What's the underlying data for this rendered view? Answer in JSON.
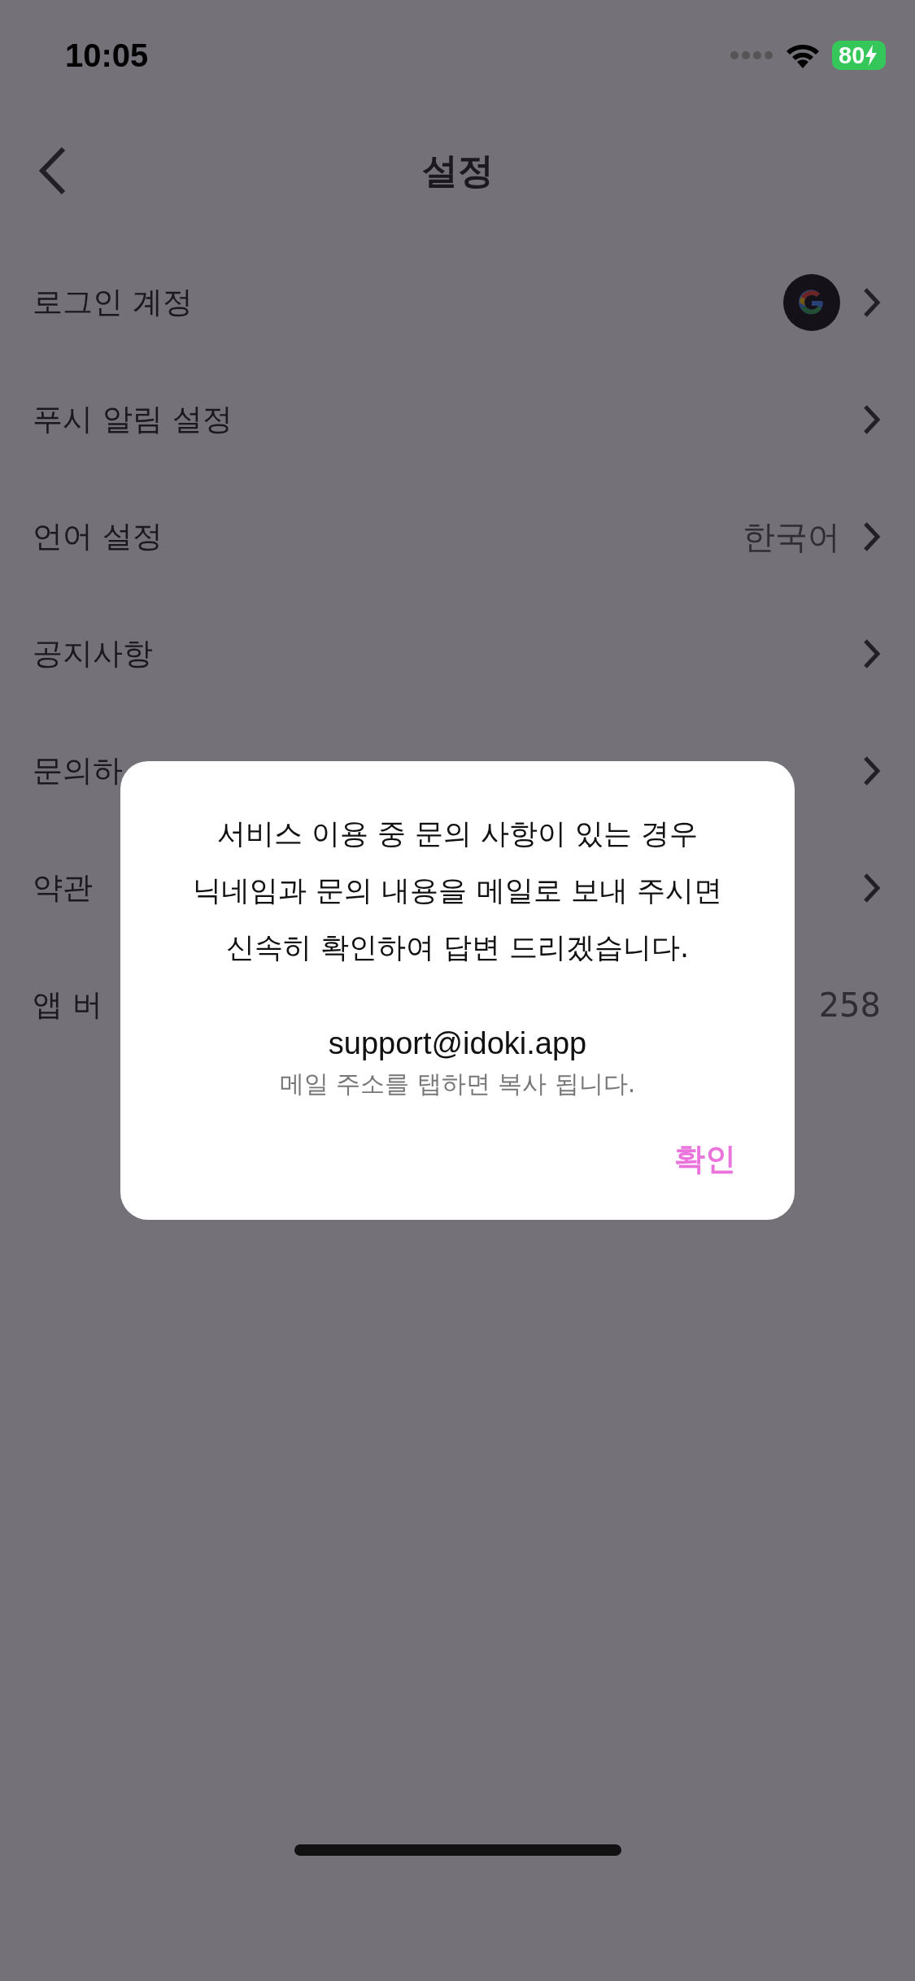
{
  "status_bar": {
    "time": "10:05",
    "battery": "80"
  },
  "header": {
    "title": "설정"
  },
  "rows": [
    {
      "label": "로그인 계정",
      "kind": "account"
    },
    {
      "label": "푸시 알림 설정",
      "kind": "link"
    },
    {
      "label": "언어 설정",
      "kind": "value",
      "value": "한국어"
    },
    {
      "label": "공지사항",
      "kind": "link"
    },
    {
      "label": "문의하",
      "kind": "link"
    },
    {
      "label": "약관",
      "kind": "link"
    },
    {
      "label": "앱 버",
      "kind": "version",
      "value": "258"
    }
  ],
  "dialog": {
    "message": "서비스 이용 중 문의 사항이 있는 경우\n닉네임과 문의 내용을 메일로 보내 주시면\n신속히 확인하여 답변 드리겠습니다.",
    "email": "support@idoki.app",
    "hint": "메일 주소를 탭하면 복사 됩니다.",
    "confirm": "확인"
  }
}
